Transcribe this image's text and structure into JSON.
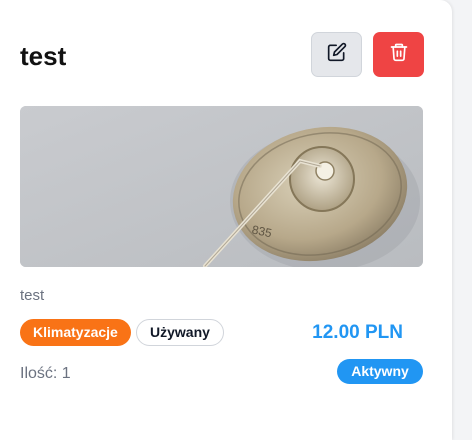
{
  "product": {
    "title": "test",
    "description": "test",
    "category_tag": "Klimatyzacje",
    "condition_tag": "Używany",
    "price": "12.00 PLN",
    "quantity_label": "Ilość:",
    "quantity_value": "1",
    "status_badge": "Aktywny"
  },
  "actions": {
    "edit_icon": "pencil-square-icon",
    "delete_icon": "trash-icon"
  },
  "colors": {
    "delete": "#ef4444",
    "category_tag": "#f97316",
    "accent": "#2196f3"
  }
}
